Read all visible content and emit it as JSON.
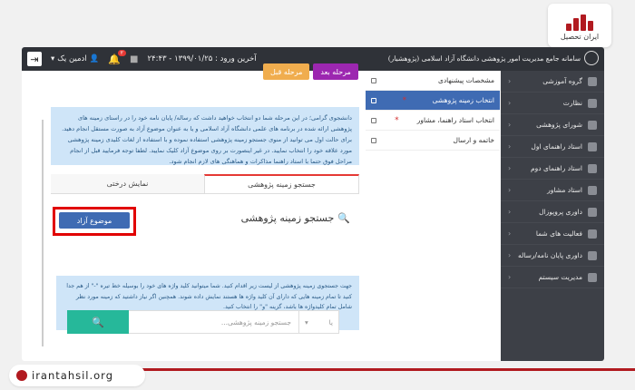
{
  "logo": {
    "text": "ایران تحصیل"
  },
  "topbar": {
    "user_name": "ادمین یک",
    "notif_count": "۲",
    "last_login": "آخرین ورود : ۱۳۹۹/۰۱/۲۵ - ۲۴:۴۳",
    "brand": "سامانه جامع مدیریت امور پژوهشی دانشگاه آزاد اسلامی (پژوهشیار)"
  },
  "step_buttons": {
    "prev": "مرحله قبل",
    "next": "مرحله بعد"
  },
  "steps": [
    {
      "label": "مشخصات پیشنهادی",
      "active": false,
      "required": false
    },
    {
      "label": "انتخاب زمینه پژوهشی",
      "active": true,
      "required": true
    },
    {
      "label": "انتخاب استاد راهنما، مشاور",
      "active": false,
      "required": true
    },
    {
      "label": "خاتمه و ارسال",
      "active": false,
      "required": false
    }
  ],
  "sidebar": {
    "items": [
      {
        "label": "گروه آموزشی"
      },
      {
        "label": "نظارت"
      },
      {
        "label": "شورای پژوهشی"
      },
      {
        "label": "استاد راهنمای اول"
      },
      {
        "label": "استاد راهنمای دوم"
      },
      {
        "label": "استاد مشاور"
      },
      {
        "label": "داوری پروپوزال"
      },
      {
        "label": "فعالیت های شما"
      },
      {
        "label": "داوری پایان نامه/رساله"
      },
      {
        "label": "مدیریت سیستم"
      }
    ]
  },
  "info_text": "دانشجوی گرامی؛ در این مرحله شما دو انتخاب خواهید داشت که رساله/ پایان نامه خود را در راستای زمینه های پژوهشی ارائه شده در برنامه های علمی دانشگاه آزاد اسلامی و یا به عنوان موضوع آزاد به صورت مستقل انجام دهید. برای حالت اول می توانید از منوی جستجو زمینه پژوهشی استفاده نموده و با استفاده از لغات کلیدی زمینه پژوهشی مورد علاقه خود را انتخاب نمایید. در غیر اینصورت بر روی موضوع آزاد کلیک نمایید. لطفا توجه فرمایید قبل از انجام مراحل فوق حتما با استاد راهنما مذاکرات و هماهنگی های لازم انجام شود.",
  "tabs": {
    "search": "جستجو زمینه پژوهشی",
    "tree": "نمایش درختی"
  },
  "search_title": "جستجو زمینه پژوهشی",
  "free_topic_button": "موضوع آزاد",
  "hint_text": "جهت جستجوی زمینه پژوهشی از لیست زیر اقدام کنید. شما میتوانید کلید واژه های خود را بوسیله خط تیره \"-\" از هم جدا کنید تا تمام زمینه هایی که دارای آن کلید واژه ها هستند نمایش داده شوند. همچنین اگر نیاز داشتید که زمینه مورد نظر شامل تمام کلیدواژه ها باشد، گزینه \"و\" را انتخاب کنید.",
  "search_input": {
    "placeholder": "جستجو زمینه پژوهشی..."
  },
  "search_select": {
    "value": "یا"
  },
  "footer": {
    "site": "irantahsil.org"
  },
  "colors": {
    "accent": "#3f6bb3",
    "highlight": "#e10000",
    "sidebar": "#3d4047",
    "brand_red": "#b11a20",
    "search_green": "#26b89a"
  }
}
